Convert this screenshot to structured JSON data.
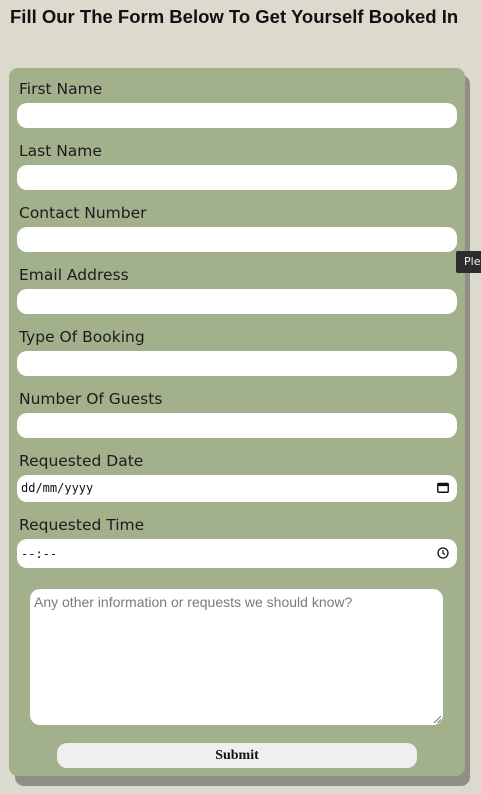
{
  "heading": "Fill Our The Form Below To Get Yourself Booked In",
  "form": {
    "first_name": {
      "label": "First Name",
      "value": ""
    },
    "last_name": {
      "label": "Last Name",
      "value": ""
    },
    "contact_number": {
      "label": "Contact Number",
      "value": ""
    },
    "email_address": {
      "label": "Email Address",
      "value": ""
    },
    "booking_type": {
      "label": "Type Of Booking",
      "value": ""
    },
    "guests": {
      "label": "Number Of Guests",
      "value": ""
    },
    "date": {
      "label": "Requested Date",
      "display": "dd/mm/yyyy",
      "icon": "calendar-icon"
    },
    "time": {
      "label": "Requested Time",
      "display": "--:--",
      "icon": "clock-icon"
    },
    "notes": {
      "placeholder": "Any other information or requests we should know?"
    },
    "submit_label": "Submit"
  },
  "tooltip": {
    "text": "Please fill in this field."
  },
  "colors": {
    "page_background": "#dcd9cd",
    "card_background": "#a2b08b",
    "card_shadow": "#8f8f88",
    "input_background": "#ffffff",
    "button_background": "#efefef"
  }
}
